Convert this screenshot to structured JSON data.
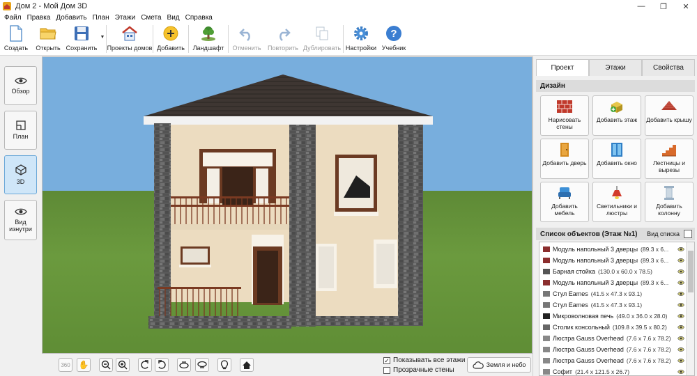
{
  "window": {
    "title": "Дом 2 - Мой Дом 3D",
    "controls": [
      "—",
      "❐",
      "✕"
    ]
  },
  "menu": [
    "Файл",
    "Правка",
    "Добавить",
    "План",
    "Этажи",
    "Смета",
    "Вид",
    "Справка"
  ],
  "toolbar": {
    "create": "Создать",
    "open": "Открыть",
    "save": "Сохранить",
    "projects": "Проекты домов",
    "add": "Добавить",
    "landscape": "Ландшафт",
    "undo": "Отменить",
    "redo": "Повторить",
    "duplicate": "Дублировать",
    "settings": "Настройки",
    "tutorial": "Учебник"
  },
  "views": {
    "overview": "Обзор",
    "plan": "План",
    "three_d": "3D",
    "inside": "Вид изнутри"
  },
  "bottom": {
    "show_all_floors": "Показывать все этажи",
    "show_all_floors_checked": true,
    "transparent_walls": "Прозрачные стены",
    "transparent_walls_checked": false,
    "sky_button": "Земля и небо"
  },
  "right": {
    "tabs": [
      "Проект",
      "Этажи",
      "Свойства"
    ],
    "active_tab": "Проект",
    "design_header": "Дизайн",
    "design_buttons": [
      {
        "label": "Нарисовать стены",
        "icon": "wall-brick-icon"
      },
      {
        "label": "Добавить этаж",
        "icon": "add-floor-icon"
      },
      {
        "label": "Добавить крышу",
        "icon": "roof-icon"
      },
      {
        "label": "Добавить дверь",
        "icon": "door-icon"
      },
      {
        "label": "Добавить окно",
        "icon": "window-icon"
      },
      {
        "label": "Лестницы и вырезы",
        "icon": "stairs-icon"
      },
      {
        "label": "Добавить мебель",
        "icon": "armchair-icon"
      },
      {
        "label": "Светильники и люстры",
        "icon": "lamp-icon"
      },
      {
        "label": "Добавить колонну",
        "icon": "column-icon"
      }
    ],
    "objects_header": "Список объектов (Этаж №1)",
    "objects_view": "Вид списка",
    "objects": [
      {
        "name": "Модуль напольный 3 дверцы",
        "dims": "(89.3 x 6...",
        "icon": "cabinet"
      },
      {
        "name": "Модуль напольный 3 дверцы",
        "dims": "(89.3 x 6...",
        "icon": "cabinet"
      },
      {
        "name": "Барная стойка",
        "dims": "(130.0 x 60.0 x 78.5)",
        "icon": "bar"
      },
      {
        "name": "Модуль напольный 3 дверцы",
        "dims": "(89.3 x 6...",
        "icon": "cabinet"
      },
      {
        "name": "Стул Eames",
        "dims": "(41.5 x 47.3 x 93.1)",
        "icon": "chair"
      },
      {
        "name": "Стул Eames",
        "dims": "(41.5 x 47.3 x 93.1)",
        "icon": "chair"
      },
      {
        "name": "Микроволновая печь",
        "dims": "(49.0 x 36.0 x 28.0)",
        "icon": "microwave"
      },
      {
        "name": "Столик консольный",
        "dims": "(109.8 x 39.5 x 80.2)",
        "icon": "table"
      },
      {
        "name": "Люстра Gauss Overhead",
        "dims": "(7.6 x 7.6 x 78.2)",
        "icon": "lamp"
      },
      {
        "name": "Люстра Gauss Overhead",
        "dims": "(7.6 x 7.6 x 78.2)",
        "icon": "lamp"
      },
      {
        "name": "Люстра Gauss Overhead",
        "dims": "(7.6 x 7.6 x 78.2)",
        "icon": "lamp"
      },
      {
        "name": "Софит",
        "dims": "(21.4 x 121.5 x 26.7)",
        "icon": "lamp"
      }
    ]
  }
}
